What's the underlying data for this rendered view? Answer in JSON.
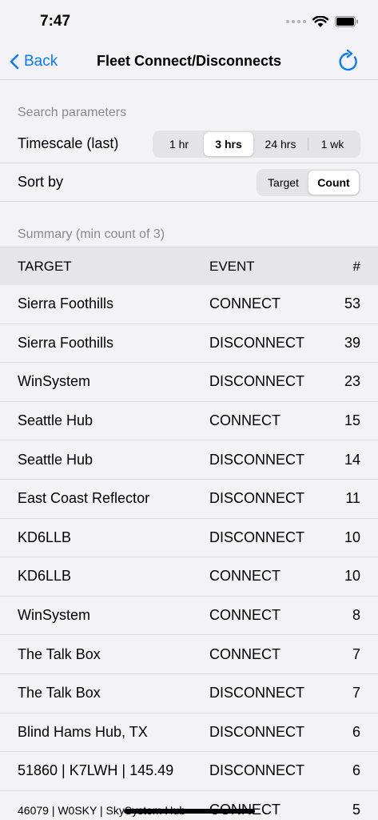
{
  "status": {
    "time": "7:47"
  },
  "nav": {
    "back_label": "Back",
    "title": "Fleet Connect/Disconnects"
  },
  "search": {
    "header": "Search parameters",
    "timescale_label": "Timescale (last)",
    "timescale_options": [
      "1 hr",
      "3 hrs",
      "24 hrs",
      "1 wk"
    ],
    "timescale_selected": "3 hrs",
    "sort_label": "Sort by",
    "sort_options": [
      "Target",
      "Count"
    ],
    "sort_selected": "Count"
  },
  "summary": {
    "header": "Summary (min count of 3)",
    "columns": {
      "target": "TARGET",
      "event": "EVENT",
      "count": "#"
    },
    "rows": [
      {
        "target": "Sierra Foothills",
        "event": "CONNECT",
        "count": "53"
      },
      {
        "target": "Sierra Foothills",
        "event": "DISCONNECT",
        "count": "39"
      },
      {
        "target": "WinSystem",
        "event": "DISCONNECT",
        "count": "23"
      },
      {
        "target": "Seattle Hub",
        "event": "CONNECT",
        "count": "15"
      },
      {
        "target": "Seattle Hub",
        "event": "DISCONNECT",
        "count": "14"
      },
      {
        "target": "East Coast Reflector",
        "event": "DISCONNECT",
        "count": "11"
      },
      {
        "target": "KD6LLB",
        "event": "DISCONNECT",
        "count": "10"
      },
      {
        "target": "KD6LLB",
        "event": "CONNECT",
        "count": "10"
      },
      {
        "target": "WinSystem",
        "event": "CONNECT",
        "count": "8"
      },
      {
        "target": "The Talk Box",
        "event": "CONNECT",
        "count": "7"
      },
      {
        "target": "The Talk Box",
        "event": "DISCONNECT",
        "count": "7"
      },
      {
        "target": "Blind Hams Hub, TX",
        "event": "DISCONNECT",
        "count": "6"
      },
      {
        "target": "51860 | K7LWH | 145.49",
        "event": "DISCONNECT",
        "count": "6"
      },
      {
        "target": "46079 | W0SKY | SkySystem Hub",
        "event": "CONNECT",
        "count": "5"
      }
    ]
  },
  "colors": {
    "accent": "#0a7aff",
    "background": "#f2f2f7",
    "header_row": "#e6e6ea"
  }
}
